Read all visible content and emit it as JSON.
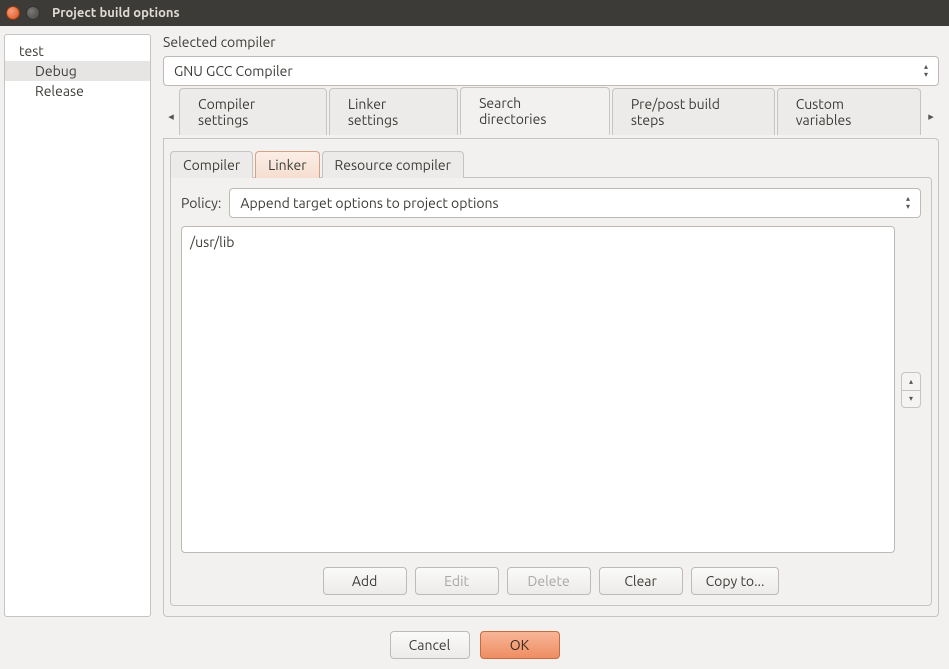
{
  "window": {
    "title": "Project build options"
  },
  "tree": {
    "root": "test",
    "children": [
      "Debug",
      "Release"
    ],
    "selected": "Debug"
  },
  "compiler": {
    "section_label": "Selected compiler",
    "value": "GNU GCC Compiler"
  },
  "main_tabs": {
    "items": [
      "Compiler settings",
      "Linker settings",
      "Search directories",
      "Pre/post build steps",
      "Custom variables"
    ],
    "active": "Search directories"
  },
  "sub_tabs": {
    "items": [
      "Compiler",
      "Linker",
      "Resource compiler"
    ],
    "active": "Linker"
  },
  "policy": {
    "label": "Policy:",
    "value": "Append target options to project options"
  },
  "directories": {
    "items": [
      "/usr/lib"
    ]
  },
  "list_buttons": {
    "add": "Add",
    "edit": "Edit",
    "delete": "Delete",
    "clear": "Clear",
    "copy_to": "Copy to..."
  },
  "footer": {
    "cancel": "Cancel",
    "ok": "OK"
  }
}
